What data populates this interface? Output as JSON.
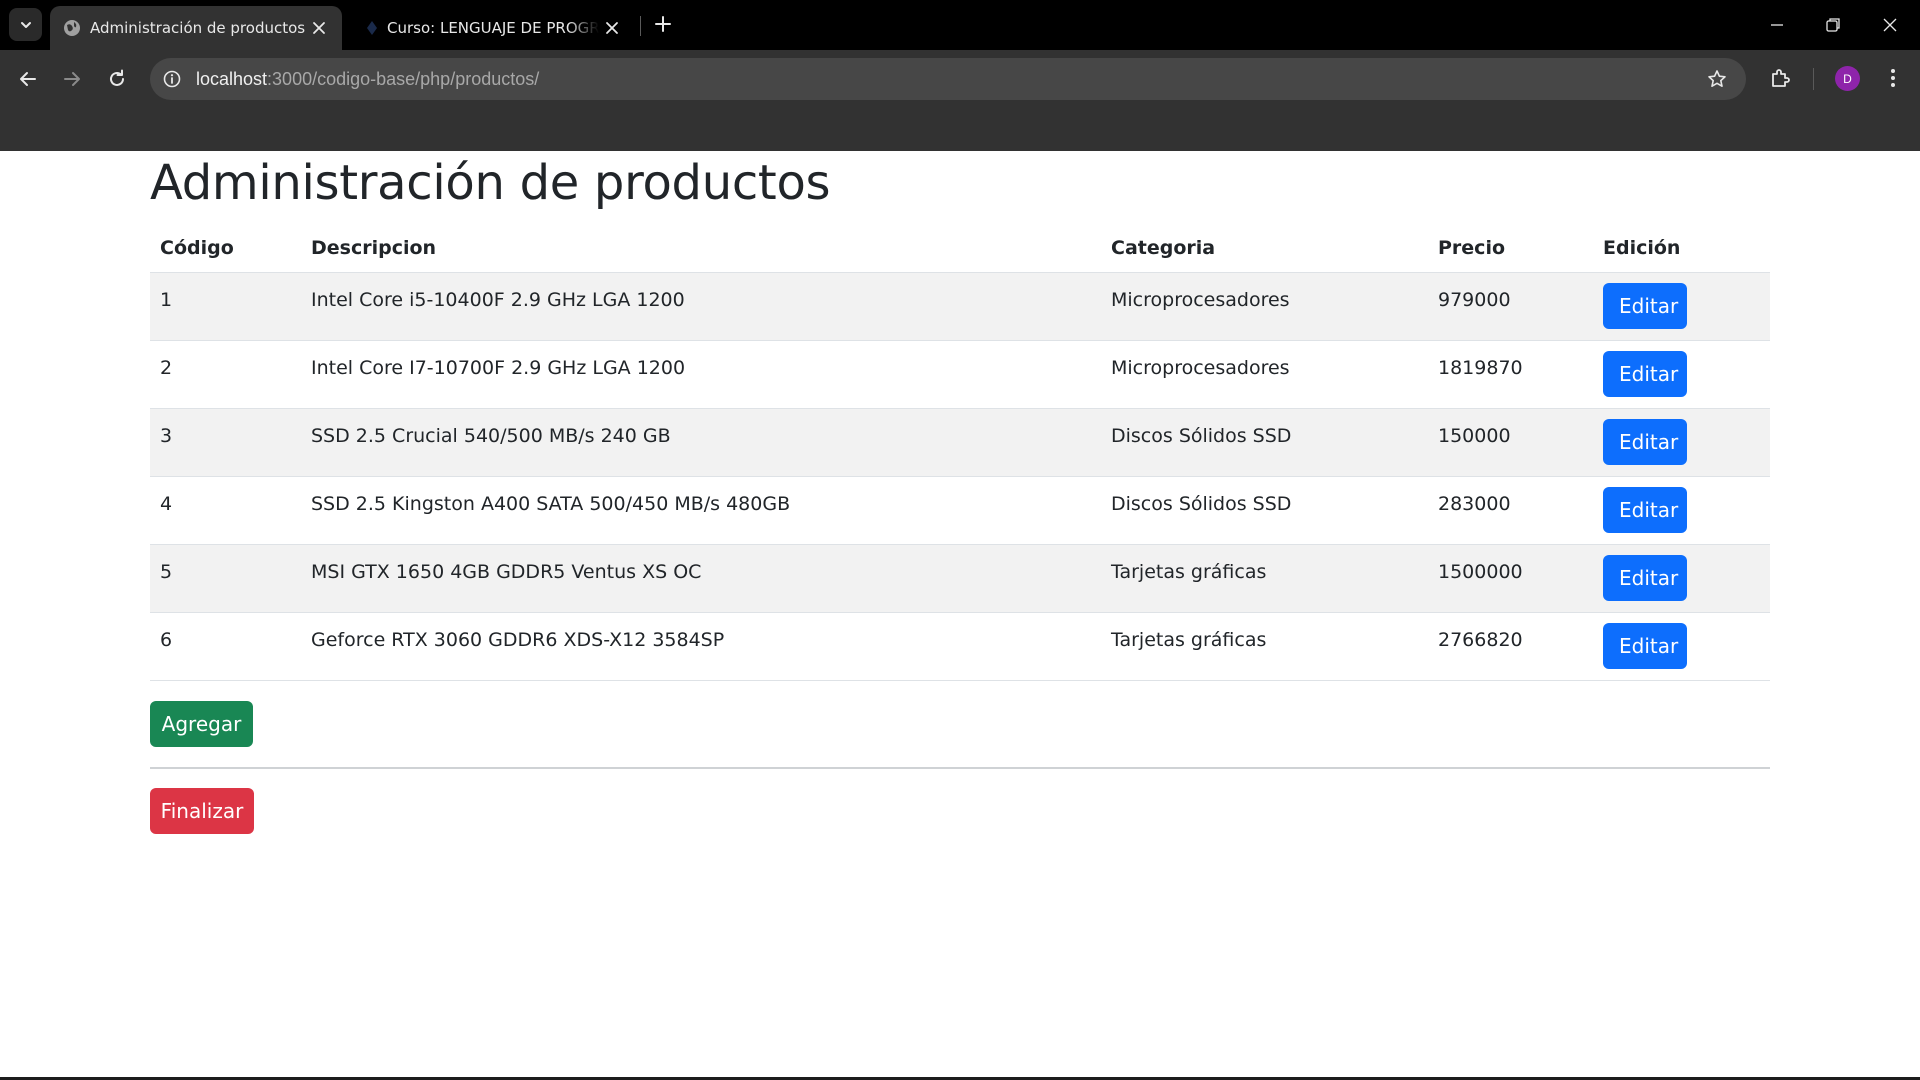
{
  "browser": {
    "tabs": [
      {
        "title": "Administración de productos",
        "active": true
      },
      {
        "title": "Curso: LENGUAJE DE PROGRAMACIÓN",
        "active": false
      }
    ],
    "address": {
      "host": "localhost",
      "path": ":3000/codigo-base/php/productos/"
    },
    "profile_initial": "D",
    "colors": {
      "tabbar": "#000000",
      "toolbar": "#323232",
      "omnibox": "#474747",
      "avatar": "#8e24aa"
    }
  },
  "page": {
    "title": "Administración de productos",
    "table": {
      "headers": {
        "code": "Código",
        "description": "Descripcion",
        "category": "Categoria",
        "price": "Precio",
        "edit": "Edición"
      },
      "rows": [
        {
          "code": "1",
          "description": "Intel Core i5-10400F 2.9 GHz LGA 1200",
          "category": "Microprocesadores",
          "price": "979000",
          "action": "Editar"
        },
        {
          "code": "2",
          "description": "Intel Core I7-10700F 2.9 GHz LGA 1200",
          "category": "Microprocesadores",
          "price": "1819870",
          "action": "Editar"
        },
        {
          "code": "3",
          "description": "SSD 2.5 Crucial 540/500 MB/s 240 GB",
          "category": "Discos Sólidos SSD",
          "price": "150000",
          "action": "Editar"
        },
        {
          "code": "4",
          "description": "SSD 2.5 Kingston A400 SATA 500/450 MB/s 480GB",
          "category": "Discos Sólidos SSD",
          "price": "283000",
          "action": "Editar"
        },
        {
          "code": "5",
          "description": "MSI GTX 1650 4GB GDDR5 Ventus XS OC",
          "category": "Tarjetas gráficas",
          "price": "1500000",
          "action": "Editar"
        },
        {
          "code": "6",
          "description": "Geforce RTX 3060 GDDR6 XDS-X12 3584SP",
          "category": "Tarjetas gráficas",
          "price": "2766820",
          "action": "Editar"
        }
      ]
    },
    "add_label": "Agregar",
    "finish_label": "Finalizar",
    "colors": {
      "primary": "#0d6efd",
      "success": "#198754",
      "danger": "#dc3545",
      "stripe": "#f2f2f2",
      "text": "#212529"
    }
  }
}
